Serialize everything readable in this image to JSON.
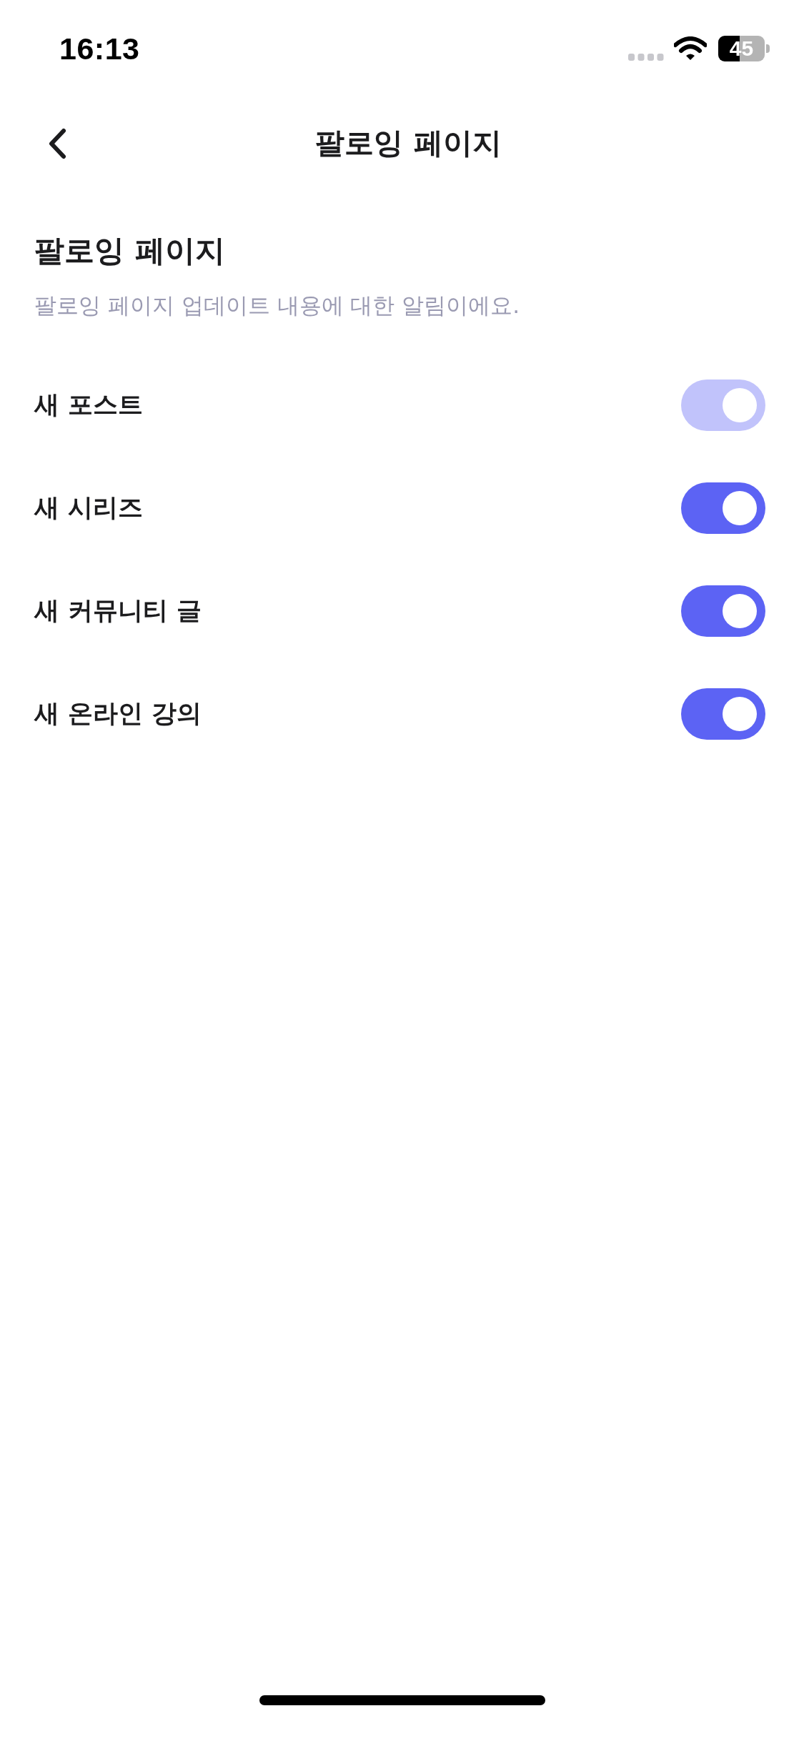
{
  "status_bar": {
    "time": "16:13",
    "battery": "45"
  },
  "header": {
    "title": "팔로잉 페이지"
  },
  "section": {
    "title": "팔로잉 페이지",
    "description": "팔로잉 페이지 업데이트 내용에 대한 알림이에요."
  },
  "settings": [
    {
      "label": "새 포스트",
      "on": true,
      "disabled": true
    },
    {
      "label": "새 시리즈",
      "on": true,
      "disabled": false
    },
    {
      "label": "새 커뮤니티 글",
      "on": true,
      "disabled": false
    },
    {
      "label": "새 온라인 강의",
      "on": true,
      "disabled": false
    }
  ]
}
